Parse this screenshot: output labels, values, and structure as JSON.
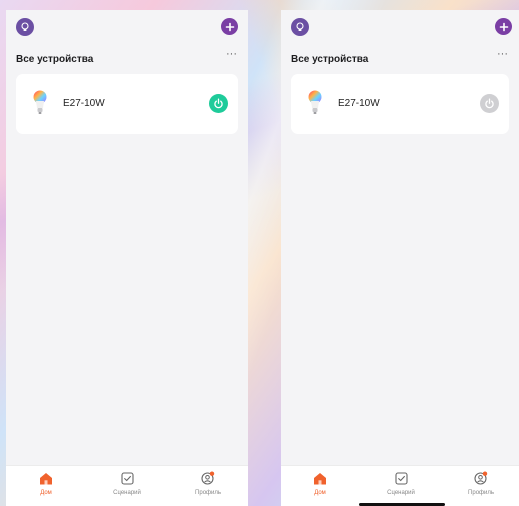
{
  "colors": {
    "accent_orange": "#f0622d",
    "power_on": "#1ecb9a",
    "power_off": "#cfcfd2",
    "add_button": "#7a3ea4",
    "avatar": "#6b4fa3"
  },
  "screens": [
    {
      "header": {
        "title": "Все устройства",
        "more_label": "···"
      },
      "device": {
        "name": "E27-10W",
        "icon": "bulb-icon",
        "power_state": "on"
      },
      "tabs": [
        {
          "label": "Дом",
          "icon": "home-icon",
          "active": true
        },
        {
          "label": "Сценарий",
          "icon": "checkbox-icon",
          "active": false
        },
        {
          "label": "Профиль",
          "icon": "profile-icon",
          "active": false
        }
      ]
    },
    {
      "header": {
        "title": "Все устройства",
        "more_label": "···"
      },
      "device": {
        "name": "E27-10W",
        "icon": "bulb-icon",
        "power_state": "off"
      },
      "tabs": [
        {
          "label": "Дом",
          "icon": "home-icon",
          "active": true
        },
        {
          "label": "Сценарий",
          "icon": "checkbox-icon",
          "active": false
        },
        {
          "label": "Профиль",
          "icon": "profile-icon",
          "active": false
        }
      ]
    }
  ]
}
